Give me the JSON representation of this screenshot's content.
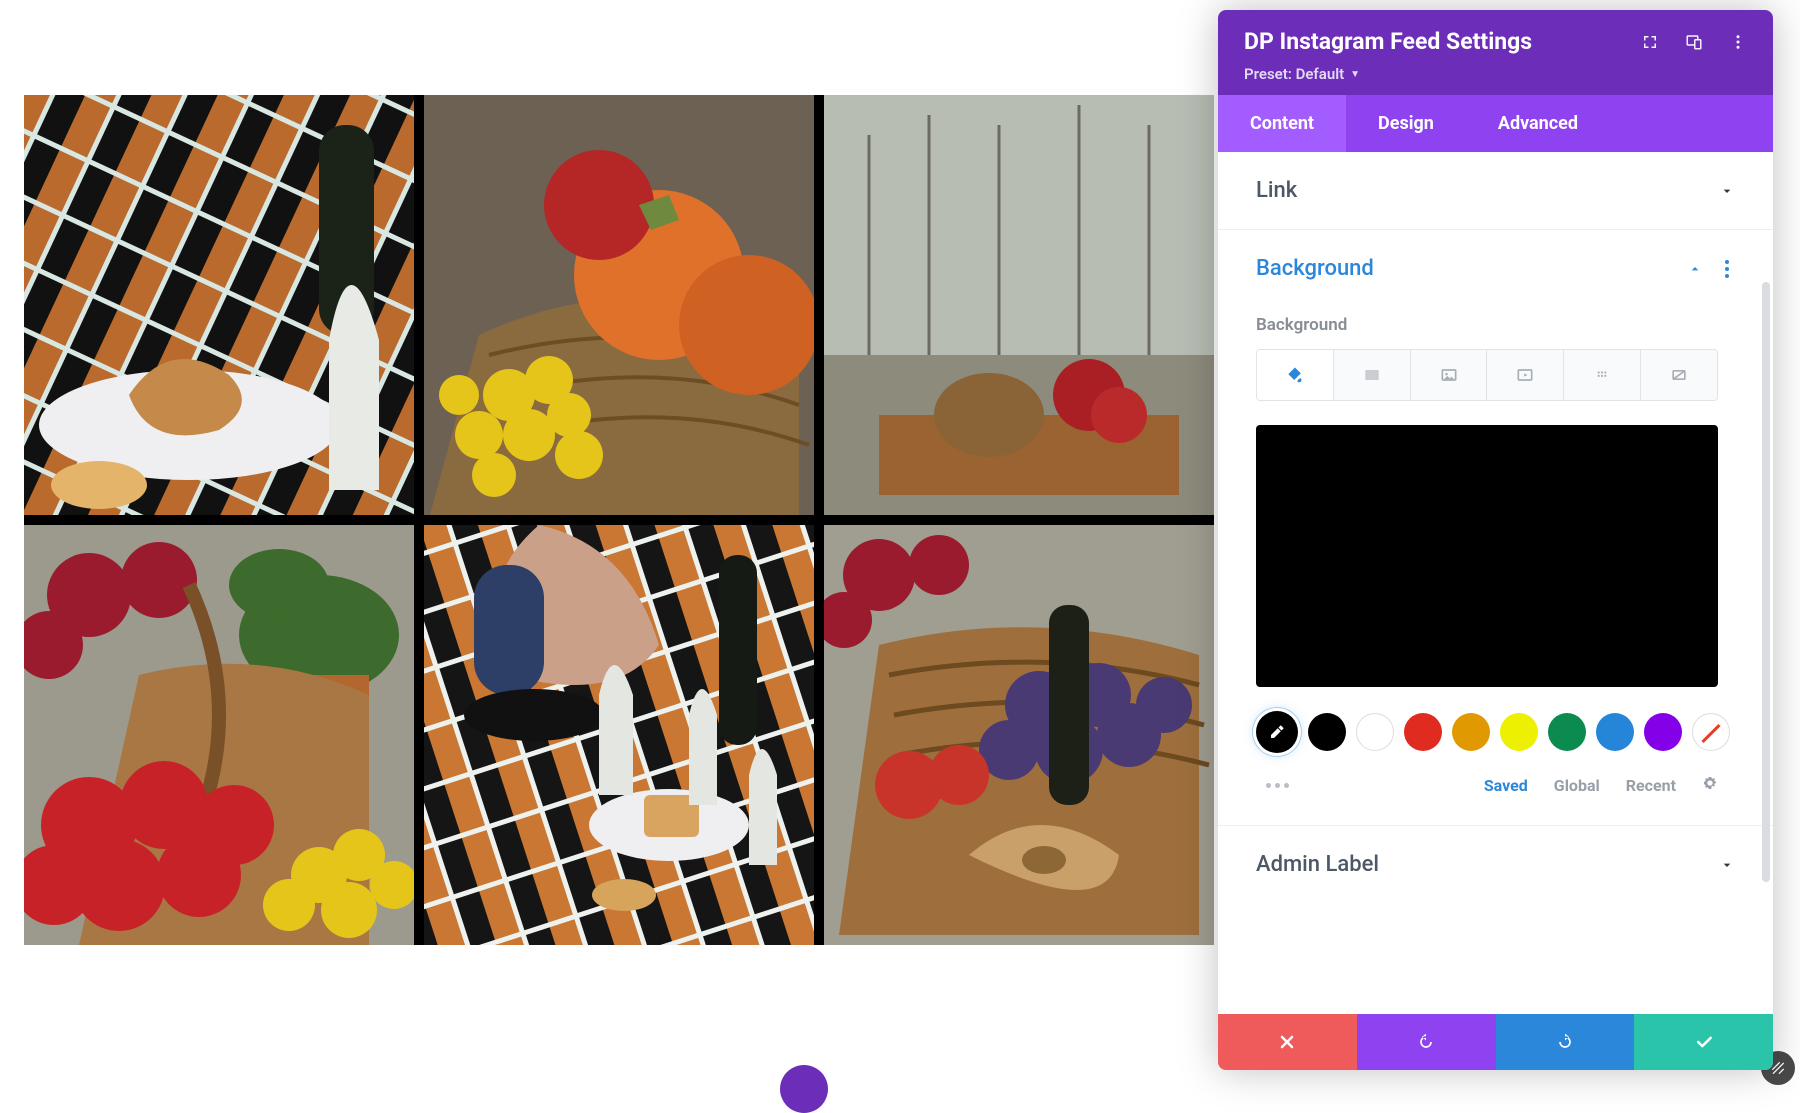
{
  "panel": {
    "title": "DP Instagram Feed Settings",
    "preset_label": "Preset: Default",
    "tabs": {
      "content": "Content",
      "design": "Design",
      "advanced": "Advanced",
      "active": "content"
    },
    "sections": {
      "link": {
        "title": "Link"
      },
      "background": {
        "title": "Background",
        "field_label": "Background",
        "type_tabs": [
          "color",
          "gradient",
          "image",
          "video",
          "pattern",
          "mask"
        ],
        "type_active": "color",
        "preview_color": "#000000",
        "swatches": [
          "#000000",
          "#ffffff",
          "#e02b20",
          "#e09900",
          "#edf000",
          "#0c8b51",
          "#2585d8",
          "#8300e9",
          "none"
        ],
        "source_tabs": {
          "saved": "Saved",
          "global": "Global",
          "recent": "Recent",
          "active": "saved"
        }
      },
      "admin_label": {
        "title": "Admin Label"
      }
    }
  },
  "icons": {
    "expand": "expand-icon",
    "responsive": "responsive-icon",
    "more": "more-vertical-icon",
    "chevron_down": "chevron-down-icon",
    "chevron_up": "chevron-up-icon",
    "paint": "paint-bucket-icon",
    "gradient": "gradient-icon",
    "image": "image-icon",
    "video": "video-icon",
    "pattern": "pattern-icon",
    "mask": "mask-icon",
    "eyedropper": "eyedropper-icon",
    "gear": "gear-icon",
    "close": "close-icon",
    "undo": "undo-icon",
    "redo": "redo-icon",
    "check": "check-icon",
    "resize": "resize-handle-icon"
  }
}
